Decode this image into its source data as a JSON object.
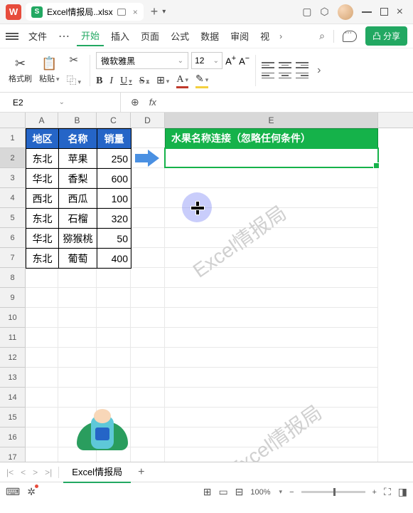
{
  "titlebar": {
    "app_badge": "W",
    "file_badge": "S",
    "filename": "Excel情报局..xlsx",
    "plus": "+",
    "dots": "⋯"
  },
  "menubar": {
    "file": "文件",
    "home": "开始",
    "insert": "插入",
    "page": "页面",
    "formula": "公式",
    "data": "数据",
    "review": "审阅",
    "view": "视",
    "share": "分享"
  },
  "toolbar": {
    "brush": "格式刷",
    "paste": "粘贴",
    "font": "微软雅黑",
    "size": "12",
    "B": "B",
    "I": "I",
    "U": "U",
    "S": "S",
    "A_big": "A",
    "A_small": "A",
    "Ac": "A",
    "Ac2": "A"
  },
  "cellbar": {
    "ref": "E2",
    "fx": "fx"
  },
  "columns": [
    "A",
    "B",
    "C",
    "D",
    "E"
  ],
  "rows_visible": 18,
  "table": {
    "headers": [
      "地区",
      "名称",
      "销量"
    ],
    "rows": [
      [
        "东北",
        "苹果",
        "250"
      ],
      [
        "华北",
        "香梨",
        "600"
      ],
      [
        "西北",
        "西瓜",
        "100"
      ],
      [
        "东北",
        "石榴",
        "320"
      ],
      [
        "华北",
        "猕猴桃",
        "50"
      ],
      [
        "东北",
        "葡萄",
        "400"
      ]
    ]
  },
  "green_header": "水果名称连接（忽略任何条件）",
  "watermark": "Excel情报局",
  "sheettab": "Excel情报局",
  "statusbar": {
    "zoom": "100%",
    "minus": "−",
    "plus": "+"
  }
}
